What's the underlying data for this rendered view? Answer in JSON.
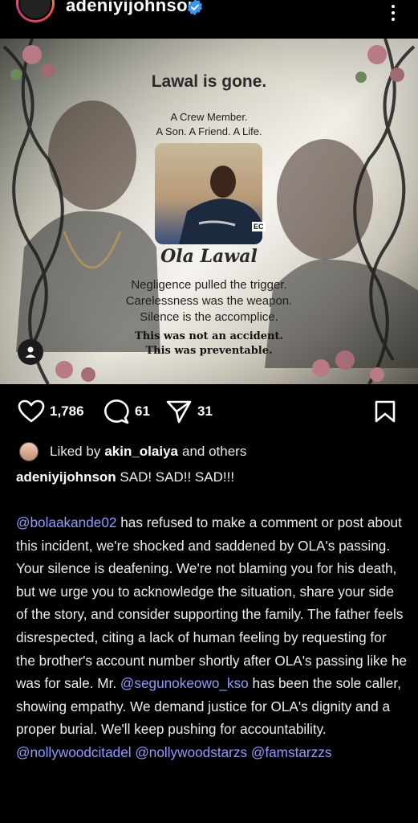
{
  "header": {
    "username": "adeniyijohnson"
  },
  "post_image": {
    "title": "Lawal is gone.",
    "subtitle_1": "A Crew Member.",
    "subtitle_2": "A Son. A Friend. A Life.",
    "photo_badge": "EC",
    "name": "Ola Lawal",
    "line_1": "Negligence pulled the trigger.",
    "line_2": "Carelessness was the weapon.",
    "line_3": "Silence is the accomplice.",
    "bold_1": "This was not an accident.",
    "bold_2": "This was preventable."
  },
  "actions": {
    "likes": "1,786",
    "comments": "61",
    "shares": "31"
  },
  "liked_by": {
    "prefix": "Liked by",
    "user": "akin_olaiya",
    "suffix": "and others"
  },
  "caption": {
    "author": "adeniyijohnson",
    "first_line": " SAD! SAD!! SAD!!!",
    "mention_1": "@bolaakande02",
    "text_1": " has refused to make a comment or post about this incident, we're shocked and saddened by OLA's passing. Your silence is deafening. We're not blaming you for his death, but we urge you to acknowledge the situation, share your side of the story, and consider supporting the family. The father feels disrespected, citing a lack of human feeling by requesting for the brother's account number shortly after OLA's passing like he was for sale. Mr. ",
    "mention_2": "@segunokeowo_kso",
    "text_2": " has been the sole caller, showing empathy. We demand justice for OLA's dignity and a proper burial. We'll keep pushing for accountability. ",
    "mention_3": "@nollywoodcitadel",
    "mention_4": "@nollywoodstarzs",
    "mention_5": "@famstarzzs"
  },
  "colors": {
    "background": "#000000",
    "mention": "#8e9cff",
    "verified": "#3897f0"
  }
}
